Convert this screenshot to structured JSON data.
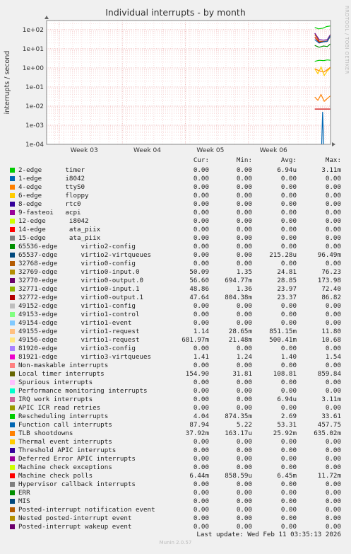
{
  "page": {
    "title": "Individual interrupts - by month",
    "side_label": "RRDTOOL / TOBI OETIKER",
    "footer": "Munin 2.0.57",
    "last_update": "Last update: Wed Feb 11 03:35:13 2026"
  },
  "chart_data": {
    "type": "line",
    "title": "Individual interrupts - by month",
    "ylabel": "interrupts / second",
    "xlabel": "",
    "y_scale": "log",
    "ylim": [
      0.0001,
      300
    ],
    "y_ticks": [
      "1e-04",
      "1e-03",
      "1e-02",
      "1e-01",
      "1e+00",
      "1e+01",
      "1e+02"
    ],
    "x_ticks": [
      "Week 03",
      "Week 04",
      "Week 05",
      "Week 06"
    ],
    "grid": true,
    "legend_position": "bottom",
    "x_range_weeks": [
      2.3,
      6.8
    ],
    "series": [
      {
        "name": "Local timer interrupts",
        "color": "#00CC00",
        "x": [
          6.55,
          6.61,
          6.68,
          6.74,
          6.8
        ],
        "values": [
          130,
          110,
          120,
          145,
          155
        ]
      },
      {
        "name": "32770-edge",
        "color": "#660099",
        "x": [
          6.55,
          6.62,
          6.69,
          6.75,
          6.8
        ],
        "values": [
          65,
          30,
          28,
          30,
          56
        ]
      },
      {
        "name": "32769-edge",
        "color": "#CC6600",
        "x": [
          6.55,
          6.62,
          6.69,
          6.75,
          6.8
        ],
        "values": [
          55,
          25,
          24,
          26,
          50
        ]
      },
      {
        "name": "32772-edge",
        "color": "#CC0000",
        "x": [
          6.55,
          6.62,
          6.69,
          6.75,
          6.8
        ],
        "values": [
          40,
          22,
          23,
          24,
          47
        ]
      },
      {
        "name": "32771-edge",
        "color": "#0066B3",
        "x": [
          6.55,
          6.62,
          6.69,
          6.75,
          6.8
        ],
        "values": [
          30,
          20,
          23,
          25,
          48
        ]
      },
      {
        "name": "Function call interrupts",
        "color": "#008F00",
        "x": [
          6.55,
          6.62,
          6.69,
          6.75,
          6.8
        ],
        "values": [
          15,
          12,
          14,
          13,
          18
        ]
      },
      {
        "name": "49155-edge",
        "color": "#FF8000",
        "x": [
          6.55,
          6.62,
          6.69,
          6.75,
          6.8
        ],
        "values": [
          0.9,
          0.7,
          0.6,
          0.8,
          1.1
        ]
      },
      {
        "name": "Rescheduling interrupts",
        "color": "#00CC00",
        "x": [
          6.55,
          6.62,
          6.69,
          6.75,
          6.8
        ],
        "values": [
          2.2,
          2.5,
          2.4,
          2.6,
          2.5
        ]
      },
      {
        "name": "Machine check polls",
        "color": "#FFCC00",
        "x": [
          6.55,
          6.6,
          6.65,
          6.7,
          6.75,
          6.8
        ],
        "values": [
          0.9,
          0.5,
          1.1,
          0.4,
          0.7,
          1.0
        ]
      },
      {
        "name": "TLB shootdowns",
        "color": "#FF8000",
        "x": [
          6.55,
          6.6,
          6.65,
          6.7,
          6.75,
          6.8
        ],
        "values": [
          0.03,
          0.02,
          0.04,
          0.018,
          0.025,
          0.035
        ]
      },
      {
        "name": "Non-maskable interrupts",
        "color": "#CC0000",
        "x": [
          6.55,
          6.8
        ],
        "values": [
          0.007,
          0.007
        ]
      },
      {
        "name": "65536-edge",
        "color": "#0066B3",
        "x": [
          6.66,
          6.675,
          6.69
        ],
        "values": [
          0.0001,
          0.005,
          0.0001
        ]
      }
    ]
  },
  "legend": {
    "headers": {
      "cur": "Cur:",
      "min": "Min:",
      "avg": "Avg:",
      "max": "Max:"
    },
    "rows": [
      {
        "label": "2-edge      timer",
        "color": "#00CC00",
        "cur": "0.00",
        "min": "0.00",
        "avg": "6.94u",
        "max": "3.11m"
      },
      {
        "label": "1-edge      i8042",
        "color": "#0066B3",
        "cur": "0.00",
        "min": "0.00",
        "avg": "0.00",
        "max": "0.00"
      },
      {
        "label": "4-edge      ttyS0",
        "color": "#FF8000",
        "cur": "0.00",
        "min": "0.00",
        "avg": "0.00",
        "max": "0.00"
      },
      {
        "label": "6-edge      floppy",
        "color": "#FFCC00",
        "cur": "0.00",
        "min": "0.00",
        "avg": "0.00",
        "max": "0.00"
      },
      {
        "label": "8-edge      rtc0",
        "color": "#330099",
        "cur": "0.00",
        "min": "0.00",
        "avg": "0.00",
        "max": "0.00"
      },
      {
        "label": "9-fasteoi   acpi",
        "color": "#990099",
        "cur": "0.00",
        "min": "0.00",
        "avg": "0.00",
        "max": "0.00"
      },
      {
        "label": "12-edge      i8042",
        "color": "#CCFF00",
        "cur": "0.00",
        "min": "0.00",
        "avg": "0.00",
        "max": "0.00"
      },
      {
        "label": "14-edge      ata_piix",
        "color": "#FF0000",
        "cur": "0.00",
        "min": "0.00",
        "avg": "0.00",
        "max": "0.00"
      },
      {
        "label": "15-edge      ata_piix",
        "color": "#808080",
        "cur": "0.00",
        "min": "0.00",
        "avg": "0.00",
        "max": "0.00"
      },
      {
        "label": "65536-edge      virtio2-config",
        "color": "#008F00",
        "cur": "0.00",
        "min": "0.00",
        "avg": "0.00",
        "max": "0.00"
      },
      {
        "label": "65537-edge      virtio2-virtqueues",
        "color": "#00487D",
        "cur": "0.00",
        "min": "0.00",
        "avg": "215.28u",
        "max": "96.49m"
      },
      {
        "label": "32768-edge      virtio0-config",
        "color": "#B35A00",
        "cur": "0.00",
        "min": "0.00",
        "avg": "0.00",
        "max": "0.00"
      },
      {
        "label": "32769-edge      virtio0-input.0",
        "color": "#B38F00",
        "cur": "50.09",
        "min": "1.35",
        "avg": "24.81",
        "max": "76.23"
      },
      {
        "label": "32770-edge      virtio0-output.0",
        "color": "#6B006B",
        "cur": "56.60",
        "min": "694.77m",
        "avg": "28.85",
        "max": "173.98"
      },
      {
        "label": "32771-edge      virtio0-input.1",
        "color": "#8FB300",
        "cur": "48.86",
        "min": "1.36",
        "avg": "23.97",
        "max": "72.40"
      },
      {
        "label": "32772-edge      virtio0-output.1",
        "color": "#B30000",
        "cur": "47.64",
        "min": "804.38m",
        "avg": "23.37",
        "max": "86.82"
      },
      {
        "label": "49152-edge      virtio1-config",
        "color": "#BEBEBE",
        "cur": "0.00",
        "min": "0.00",
        "avg": "0.00",
        "max": "0.00"
      },
      {
        "label": "49153-edge      virtio1-control",
        "color": "#80FF80",
        "cur": "0.00",
        "min": "0.00",
        "avg": "0.00",
        "max": "0.00"
      },
      {
        "label": "49154-edge      virtio1-event",
        "color": "#80C9FF",
        "cur": "0.00",
        "min": "0.00",
        "avg": "0.00",
        "max": "0.00"
      },
      {
        "label": "49155-edge      virtio1-request",
        "color": "#FFC080",
        "cur": "1.14",
        "min": "28.65m",
        "avg": "851.15m",
        "max": "11.80"
      },
      {
        "label": "49156-edge      virtio1-request",
        "color": "#FFE680",
        "cur": "681.97m",
        "min": "21.48m",
        "avg": "500.41m",
        "max": "10.68"
      },
      {
        "label": "81920-edge      virtio3-config",
        "color": "#AA80FF",
        "cur": "0.00",
        "min": "0.00",
        "avg": "0.00",
        "max": "0.00"
      },
      {
        "label": "81921-edge      virtio3-virtqueues",
        "color": "#EE00CC",
        "cur": "1.41",
        "min": "1.24",
        "avg": "1.40",
        "max": "1.54"
      },
      {
        "label": "Non-maskable interrupts",
        "color": "#FF8080",
        "cur": "0.00",
        "min": "0.00",
        "avg": "0.00",
        "max": "0.00"
      },
      {
        "label": "Local timer interrupts",
        "color": "#666600",
        "cur": "154.90",
        "min": "31.81",
        "avg": "108.81",
        "max": "859.84"
      },
      {
        "label": "Spurious interrupts",
        "color": "#FFBFFF",
        "cur": "0.00",
        "min": "0.00",
        "avg": "0.00",
        "max": "0.00"
      },
      {
        "label": "Performance monitoring interrupts",
        "color": "#00FFCC",
        "cur": "0.00",
        "min": "0.00",
        "avg": "0.00",
        "max": "0.00"
      },
      {
        "label": "IRQ work interrupts",
        "color": "#CC6699",
        "cur": "0.00",
        "min": "0.00",
        "avg": "6.94u",
        "max": "3.11m"
      },
      {
        "label": "APIC ICR read retries",
        "color": "#999900",
        "cur": "0.00",
        "min": "0.00",
        "avg": "0.00",
        "max": "0.00"
      },
      {
        "label": "Rescheduling interrupts",
        "color": "#00CC00",
        "cur": "4.04",
        "min": "874.35m",
        "avg": "2.69",
        "max": "33.61"
      },
      {
        "label": "Function call interrupts",
        "color": "#0066B3",
        "cur": "87.94",
        "min": "5.22",
        "avg": "53.31",
        "max": "457.75"
      },
      {
        "label": "TLB shootdowns",
        "color": "#FF8000",
        "cur": "37.92m",
        "min": "163.17u",
        "avg": "25.92m",
        "max": "635.02m"
      },
      {
        "label": "Thermal event interrupts",
        "color": "#FFCC00",
        "cur": "0.00",
        "min": "0.00",
        "avg": "0.00",
        "max": "0.00"
      },
      {
        "label": "Threshold APIC interrupts",
        "color": "#330099",
        "cur": "0.00",
        "min": "0.00",
        "avg": "0.00",
        "max": "0.00"
      },
      {
        "label": "Deferred Error APIC interrupts",
        "color": "#990099",
        "cur": "0.00",
        "min": "0.00",
        "avg": "0.00",
        "max": "0.00"
      },
      {
        "label": "Machine check exceptions",
        "color": "#CCFF00",
        "cur": "0.00",
        "min": "0.00",
        "avg": "0.00",
        "max": "0.00"
      },
      {
        "label": "Machine check polls",
        "color": "#FF0000",
        "cur": "6.44m",
        "min": "858.59u",
        "avg": "6.45m",
        "max": "11.72m"
      },
      {
        "label": "Hypervisor callback interrupts",
        "color": "#808080",
        "cur": "0.00",
        "min": "0.00",
        "avg": "0.00",
        "max": "0.00"
      },
      {
        "label": "ERR",
        "color": "#008F00",
        "cur": "0.00",
        "min": "0.00",
        "avg": "0.00",
        "max": "0.00"
      },
      {
        "label": "MIS",
        "color": "#00487D",
        "cur": "0.00",
        "min": "0.00",
        "avg": "0.00",
        "max": "0.00"
      },
      {
        "label": "Posted-interrupt notification event",
        "color": "#B35A00",
        "cur": "0.00",
        "min": "0.00",
        "avg": "0.00",
        "max": "0.00"
      },
      {
        "label": "Nested posted-interrupt event",
        "color": "#B38F00",
        "cur": "0.00",
        "min": "0.00",
        "avg": "0.00",
        "max": "0.00"
      },
      {
        "label": "Posted-interrupt wakeup event",
        "color": "#6B006B",
        "cur": "0.00",
        "min": "0.00",
        "avg": "0.00",
        "max": "0.00"
      }
    ]
  }
}
